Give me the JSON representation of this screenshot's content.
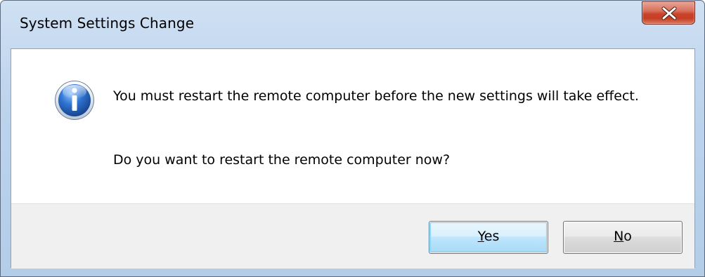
{
  "window": {
    "title": "System Settings Change"
  },
  "dialog": {
    "icon": "information-icon",
    "message": "You must restart the remote computer before the new settings will take effect.",
    "question": "Do you want to restart the remote computer now?"
  },
  "buttons": {
    "yes": {
      "mnemonic": "Y",
      "rest": "es"
    },
    "no": {
      "mnemonic": "N",
      "rest": "o"
    }
  },
  "colors": {
    "close_button": "#c9432b",
    "default_button_border": "#3c7fb1",
    "info_icon_blue": "#1e5fb8"
  }
}
